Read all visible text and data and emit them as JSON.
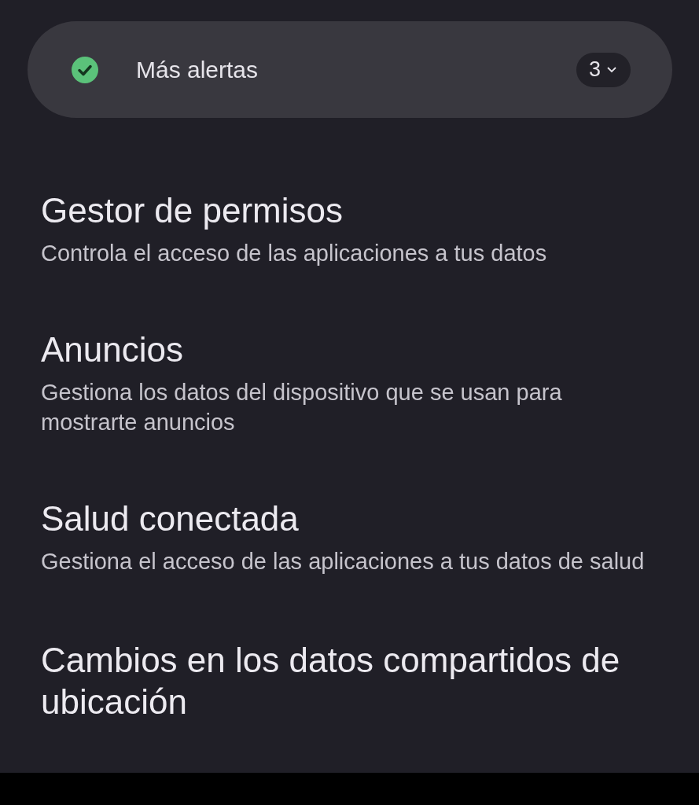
{
  "alert_banner": {
    "checked": true,
    "label": "Más alertas",
    "count": "3",
    "expanded": false
  },
  "items": [
    {
      "title": "Gestor de permisos",
      "subtitle": "Controla el acceso de las aplicaciones a tus datos"
    },
    {
      "title": "Anuncios",
      "subtitle": "Gestiona los datos del dispositivo que se usan para mostrarte anuncios"
    },
    {
      "title": "Salud conectada",
      "subtitle": "Gestiona el acceso de las aplicaciones a tus datos de salud"
    },
    {
      "title": "Cambios en los datos compartidos de ubicación"
    }
  ]
}
